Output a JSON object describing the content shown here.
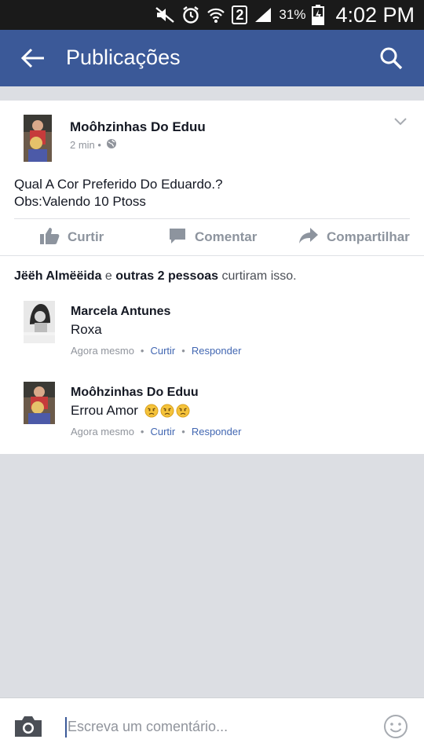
{
  "status_bar": {
    "battery": "31%",
    "sim": "2",
    "time": "4:02 PM"
  },
  "app_bar": {
    "title": "Publicações",
    "back_icon": "arrow-left-icon",
    "search_icon": "search-icon"
  },
  "post": {
    "author": "Moôhzinhas Do Eduu",
    "time": "2 min",
    "privacy_icon": "globe-icon",
    "text_line1": "Qual A Cor Preferido Do Eduardo.?",
    "text_line2": "Obs:Valendo 10 Ptoss",
    "actions": {
      "like": "Curtir",
      "comment": "Comentar",
      "share": "Compartilhar"
    },
    "likes": {
      "name": "Jëëh Almëëida",
      "connector": "e",
      "others": "outras 2 pessoas",
      "suffix": "curtiram isso."
    }
  },
  "comments": [
    {
      "name": "Marcela Antunes",
      "text": "Roxa",
      "time": "Agora mesmo",
      "like": "Curtir",
      "reply": "Responder"
    },
    {
      "name": "Moôhzinhas Do Eduu",
      "text": "Errou Amor",
      "emoji_count": 3,
      "emoji_icon": "angry-face-icon",
      "time": "Agora mesmo",
      "like": "Curtir",
      "reply": "Responder"
    }
  ],
  "composer": {
    "placeholder": "Escreva um comentário...",
    "camera_icon": "camera-icon",
    "emoji_icon": "smiley-icon"
  },
  "colors": {
    "brand": "#3b5998",
    "link": "#4267b2",
    "background": "#dcdee3"
  }
}
